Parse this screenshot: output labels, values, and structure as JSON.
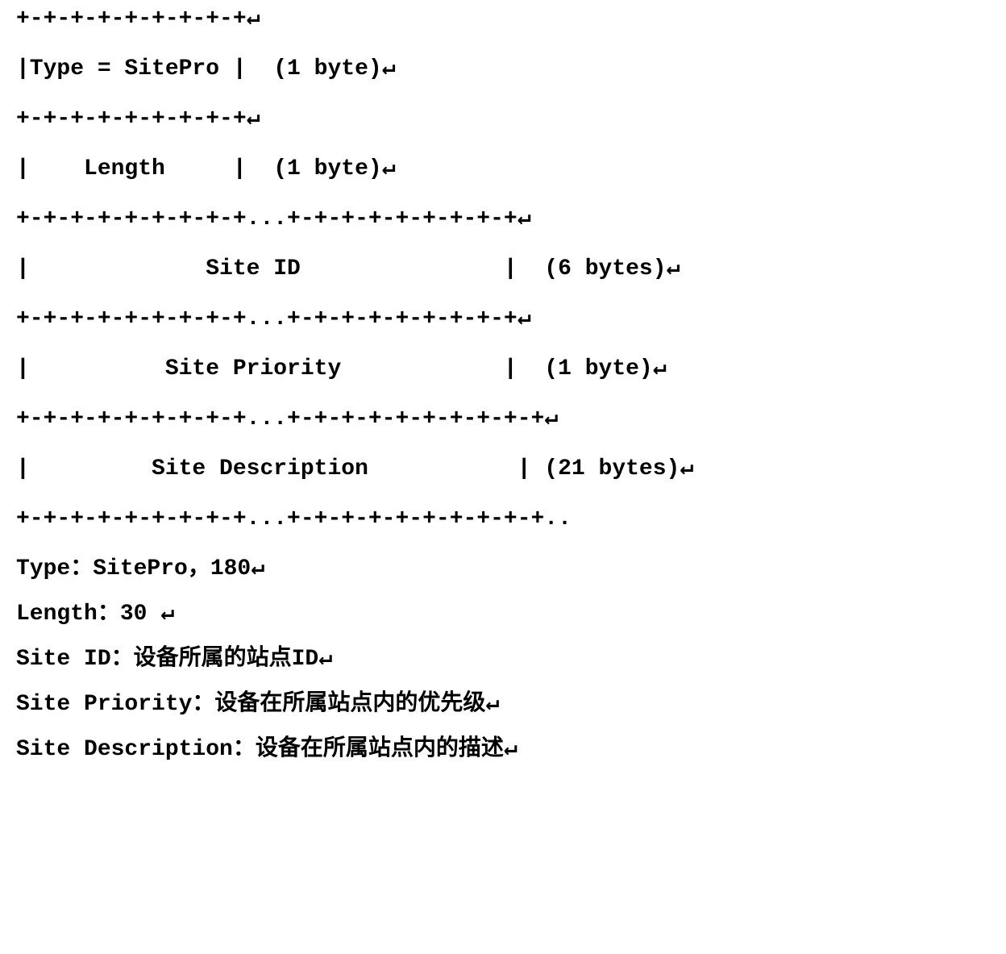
{
  "lines": {
    "r1": "+-+-+-+-+-+-+-+-+↵",
    "r2": "|Type = SitePro |  (1 byte)↵",
    "r3": "+-+-+-+-+-+-+-+-+↵",
    "r4": "|    Length     |  (1 byte)↵",
    "r5": "+-+-+-+-+-+-+-+-+...+-+-+-+-+-+-+-+-+↵",
    "r6": "|             Site ID               |  (6 bytes)↵",
    "r7": "+-+-+-+-+-+-+-+-+...+-+-+-+-+-+-+-+-+↵",
    "r8": "|          Site Priority            |  (1 byte)↵",
    "r9": "+-+-+-+-+-+-+-+-+...+-+-+-+-+-+-+-+-+-+↵",
    "r10": "|         Site Description           | (21 bytes)↵",
    "r11": "+-+-+-+-+-+-+-+-+...+-+-+-+-+-+-+-+-+-+.."
  },
  "desc": {
    "d1": "Type：SitePro，180↵",
    "d2": "Length：30 ↵",
    "d3": "Site ID：设备所属的站点ID↵",
    "d4": "Site Priority：设备在所属站点内的优先级↵",
    "d5": "Site Description：设备在所属站点内的描述↵"
  }
}
